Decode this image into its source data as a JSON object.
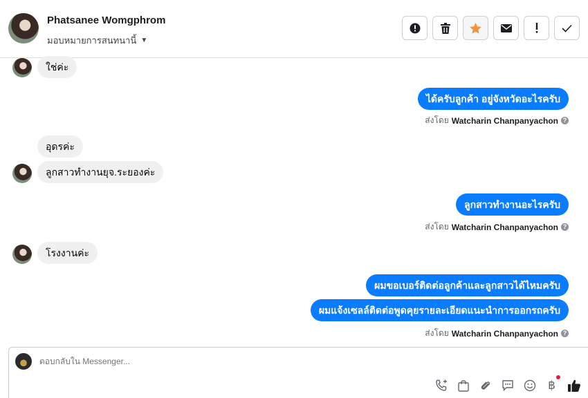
{
  "header": {
    "name": "Phatsanee Womgphrom",
    "assign_label": "มอบหมายการสนทนานี้"
  },
  "actions": [
    {
      "icon": "alert-circle-icon",
      "name": "mark-spam-button"
    },
    {
      "icon": "trash-icon",
      "name": "delete-button"
    },
    {
      "icon": "star-icon",
      "name": "star-button"
    },
    {
      "icon": "envelope-icon",
      "name": "mark-unread-button"
    },
    {
      "icon": "exclamation-icon",
      "name": "follow-up-button"
    },
    {
      "icon": "check-icon",
      "name": "mark-done-button"
    }
  ],
  "messages": {
    "m1": "ใช่ค่ะ",
    "m2": "ได้ครับลูกค้า อยู่จังหวัดอะไรครับ",
    "m3": "อุดรค่ะ",
    "m4": "ลูกสาวทำงานยุจ.ระยองค่ะ",
    "m5": "ลูกสาวทำงานอะไรครับ",
    "m6": "โรงงานค่ะ",
    "m7": "ผมขอเบอร์ติดต่อลูกค้าและลูกสาวได้ไหมครับ",
    "m8": "ผมแจ้งเซลล์ติดต่อพูดคุยรายละเอียดแนะนำการออกรถครับ"
  },
  "sent_by": {
    "prefix": "ส่งโดย",
    "agent": "Watcharin Chanpanyachon"
  },
  "composer": {
    "placeholder": "ตอบกลับใน Messenger..."
  },
  "colors": {
    "outgoing": "#0a7cff",
    "incoming": "#f0f0f0",
    "star": "#f7923a"
  }
}
